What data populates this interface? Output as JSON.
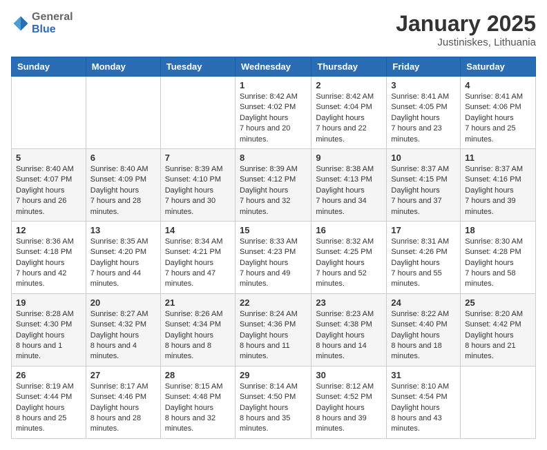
{
  "header": {
    "logo": {
      "general": "General",
      "blue": "Blue"
    },
    "title": "January 2025",
    "location": "Justiniskes, Lithuania"
  },
  "weekdays": [
    "Sunday",
    "Monday",
    "Tuesday",
    "Wednesday",
    "Thursday",
    "Friday",
    "Saturday"
  ],
  "weeks": [
    [
      null,
      null,
      null,
      {
        "day": "1",
        "sunrise": "8:42 AM",
        "sunset": "4:02 PM",
        "daylight": "7 hours and 20 minutes."
      },
      {
        "day": "2",
        "sunrise": "8:42 AM",
        "sunset": "4:04 PM",
        "daylight": "7 hours and 22 minutes."
      },
      {
        "day": "3",
        "sunrise": "8:41 AM",
        "sunset": "4:05 PM",
        "daylight": "7 hours and 23 minutes."
      },
      {
        "day": "4",
        "sunrise": "8:41 AM",
        "sunset": "4:06 PM",
        "daylight": "7 hours and 25 minutes."
      }
    ],
    [
      {
        "day": "5",
        "sunrise": "8:40 AM",
        "sunset": "4:07 PM",
        "daylight": "7 hours and 26 minutes."
      },
      {
        "day": "6",
        "sunrise": "8:40 AM",
        "sunset": "4:09 PM",
        "daylight": "7 hours and 28 minutes."
      },
      {
        "day": "7",
        "sunrise": "8:39 AM",
        "sunset": "4:10 PM",
        "daylight": "7 hours and 30 minutes."
      },
      {
        "day": "8",
        "sunrise": "8:39 AM",
        "sunset": "4:12 PM",
        "daylight": "7 hours and 32 minutes."
      },
      {
        "day": "9",
        "sunrise": "8:38 AM",
        "sunset": "4:13 PM",
        "daylight": "7 hours and 34 minutes."
      },
      {
        "day": "10",
        "sunrise": "8:37 AM",
        "sunset": "4:15 PM",
        "daylight": "7 hours and 37 minutes."
      },
      {
        "day": "11",
        "sunrise": "8:37 AM",
        "sunset": "4:16 PM",
        "daylight": "7 hours and 39 minutes."
      }
    ],
    [
      {
        "day": "12",
        "sunrise": "8:36 AM",
        "sunset": "4:18 PM",
        "daylight": "7 hours and 42 minutes."
      },
      {
        "day": "13",
        "sunrise": "8:35 AM",
        "sunset": "4:20 PM",
        "daylight": "7 hours and 44 minutes."
      },
      {
        "day": "14",
        "sunrise": "8:34 AM",
        "sunset": "4:21 PM",
        "daylight": "7 hours and 47 minutes."
      },
      {
        "day": "15",
        "sunrise": "8:33 AM",
        "sunset": "4:23 PM",
        "daylight": "7 hours and 49 minutes."
      },
      {
        "day": "16",
        "sunrise": "8:32 AM",
        "sunset": "4:25 PM",
        "daylight": "7 hours and 52 minutes."
      },
      {
        "day": "17",
        "sunrise": "8:31 AM",
        "sunset": "4:26 PM",
        "daylight": "7 hours and 55 minutes."
      },
      {
        "day": "18",
        "sunrise": "8:30 AM",
        "sunset": "4:28 PM",
        "daylight": "7 hours and 58 minutes."
      }
    ],
    [
      {
        "day": "19",
        "sunrise": "8:28 AM",
        "sunset": "4:30 PM",
        "daylight": "8 hours and 1 minute."
      },
      {
        "day": "20",
        "sunrise": "8:27 AM",
        "sunset": "4:32 PM",
        "daylight": "8 hours and 4 minutes."
      },
      {
        "day": "21",
        "sunrise": "8:26 AM",
        "sunset": "4:34 PM",
        "daylight": "8 hours and 8 minutes."
      },
      {
        "day": "22",
        "sunrise": "8:24 AM",
        "sunset": "4:36 PM",
        "daylight": "8 hours and 11 minutes."
      },
      {
        "day": "23",
        "sunrise": "8:23 AM",
        "sunset": "4:38 PM",
        "daylight": "8 hours and 14 minutes."
      },
      {
        "day": "24",
        "sunrise": "8:22 AM",
        "sunset": "4:40 PM",
        "daylight": "8 hours and 18 minutes."
      },
      {
        "day": "25",
        "sunrise": "8:20 AM",
        "sunset": "4:42 PM",
        "daylight": "8 hours and 21 minutes."
      }
    ],
    [
      {
        "day": "26",
        "sunrise": "8:19 AM",
        "sunset": "4:44 PM",
        "daylight": "8 hours and 25 minutes."
      },
      {
        "day": "27",
        "sunrise": "8:17 AM",
        "sunset": "4:46 PM",
        "daylight": "8 hours and 28 minutes."
      },
      {
        "day": "28",
        "sunrise": "8:15 AM",
        "sunset": "4:48 PM",
        "daylight": "8 hours and 32 minutes."
      },
      {
        "day": "29",
        "sunrise": "8:14 AM",
        "sunset": "4:50 PM",
        "daylight": "8 hours and 35 minutes."
      },
      {
        "day": "30",
        "sunrise": "8:12 AM",
        "sunset": "4:52 PM",
        "daylight": "8 hours and 39 minutes."
      },
      {
        "day": "31",
        "sunrise": "8:10 AM",
        "sunset": "4:54 PM",
        "daylight": "8 hours and 43 minutes."
      },
      null
    ]
  ],
  "labels": {
    "sunrise": "Sunrise:",
    "sunset": "Sunset:",
    "daylight": "Daylight hours"
  }
}
